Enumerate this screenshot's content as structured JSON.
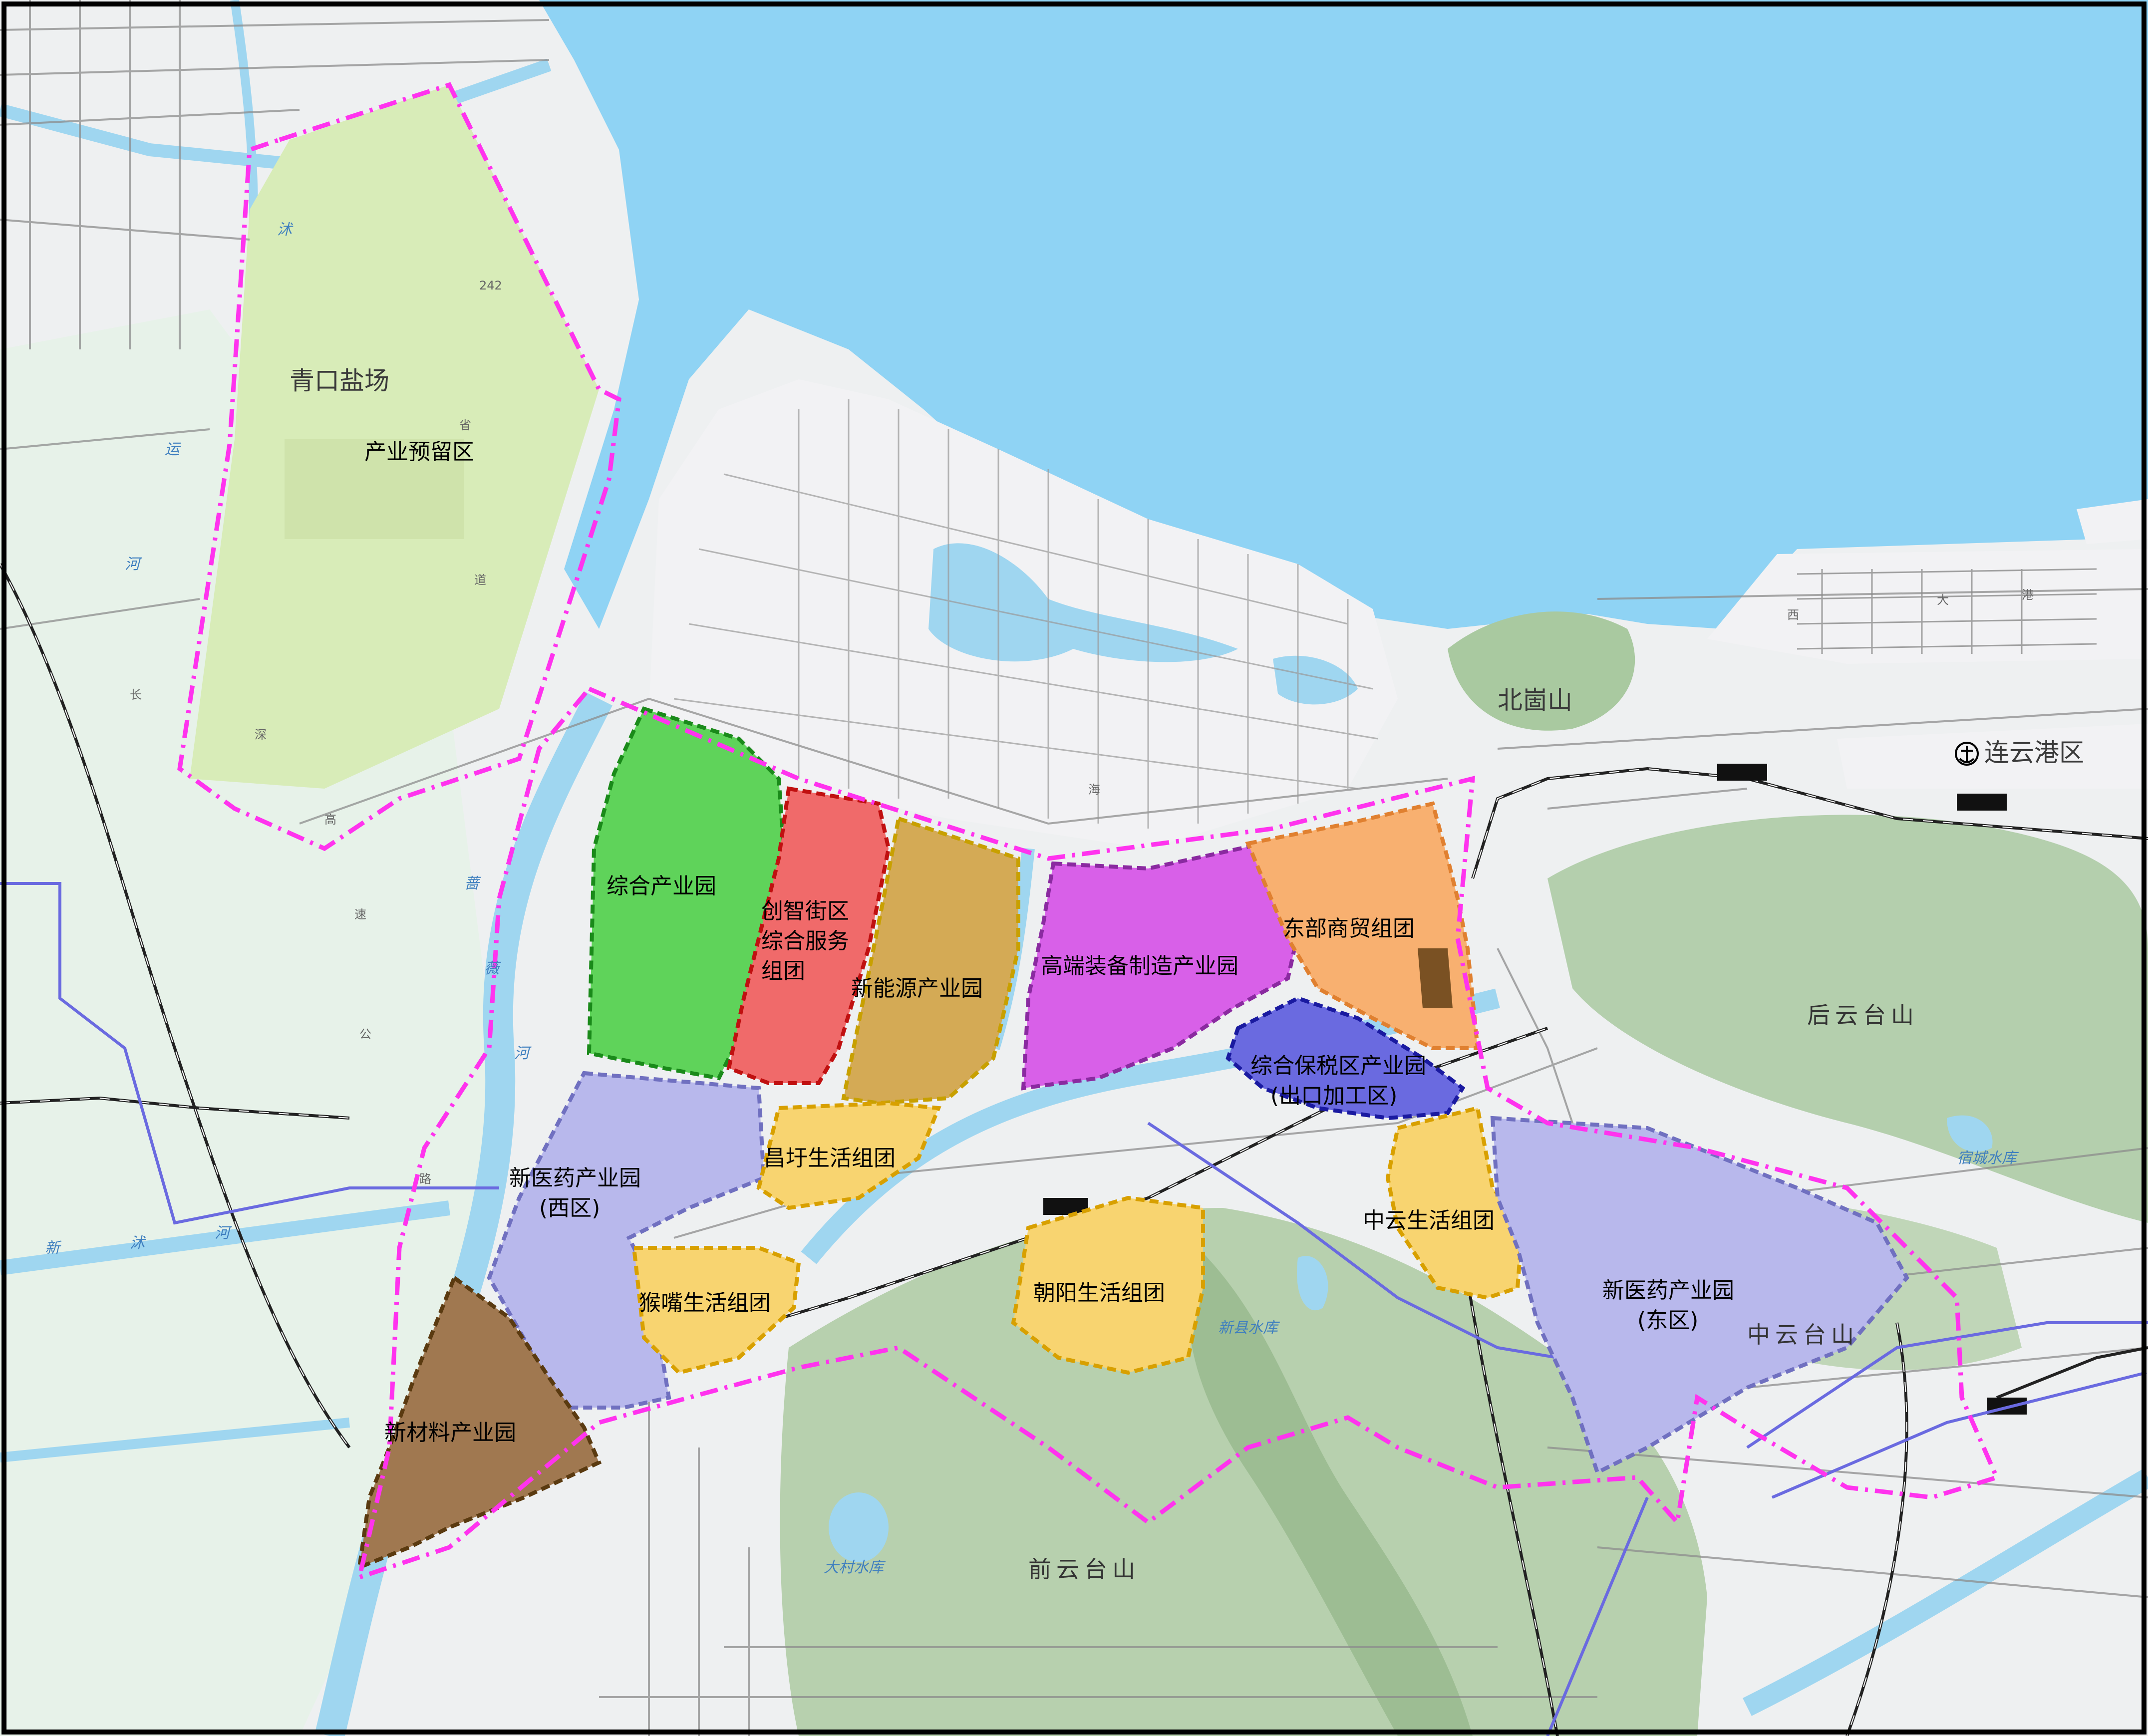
{
  "map": {
    "colors": {
      "sea": "#8fd3f4",
      "land": "#f0f0f2",
      "greenland": "#e6f2e6",
      "road": "#8a8a8a",
      "river": "#9fd6f0",
      "boundary": "#ff33ee",
      "railway": "#222222"
    },
    "places": {
      "qingkou_saltfield": "青口盐场",
      "beigushan": "北崮山",
      "port": "连云港区",
      "port_icon": "anchor-icon",
      "houyuntai": "后云台山",
      "zhongyuntai": "中云台山",
      "qianyuntai": "前云台山"
    },
    "zones": {
      "reserve": {
        "name": "产业预留区",
        "color": "#d8ecb8"
      },
      "comprehensive": {
        "name": "综合产业园",
        "color": "#5fd35a",
        "border": "#1a8a1a"
      },
      "innovation_1": {
        "name": "创智街区",
        "line2": "综合服务",
        "line3": "组团",
        "color": "#f06a6a",
        "border": "#c01010"
      },
      "new_energy": {
        "name": "新能源产业园",
        "color": "#d4aa55",
        "border": "#c8a000"
      },
      "high_end": {
        "name": "高端装备制造产业园",
        "color": "#d860e8",
        "border": "#8a2aa0"
      },
      "east_trade": {
        "name": "东部商贸组团",
        "color": "#f8b070",
        "border": "#e08030"
      },
      "bonded_1": {
        "name": "综合保税区产业园",
        "line2": "(出口加工区)",
        "color": "#6a6ae0",
        "border": "#1a1aa0"
      },
      "pharma_west": {
        "name": "新医药产业园",
        "line2": "(西区)",
        "color": "#b8b8ec",
        "border": "#7070c0"
      },
      "changyu": {
        "name": "昌圩生活组团",
        "color": "#f8d470",
        "border": "#d8a000"
      },
      "houzui": {
        "name": "猴嘴生活组团",
        "color": "#f8d470",
        "border": "#d8a000"
      },
      "chaoyang": {
        "name": "朝阳生活组团",
        "color": "#f8d470",
        "border": "#d8a000"
      },
      "zhongyun": {
        "name": "中云生活组团",
        "color": "#f8d470",
        "border": "#d8a000"
      },
      "pharma_east": {
        "name": "新医药产业园",
        "line2": "(东区)",
        "color": "#b8b8ec",
        "border": "#7070c0"
      },
      "new_material": {
        "name": "新材料产业园",
        "color": "#a07850",
        "border": "#5a3a10"
      }
    },
    "road_chars": [
      "242",
      "省",
      "道",
      "长",
      "深",
      "高",
      "速",
      "公",
      "路",
      "大",
      "港",
      "海",
      "西"
    ],
    "water_chars": [
      "沭",
      "蔷",
      "薇",
      "河",
      "新",
      "沭",
      "河",
      "大村水库",
      "新县水库",
      "宿城水库",
      "运",
      "河"
    ]
  }
}
